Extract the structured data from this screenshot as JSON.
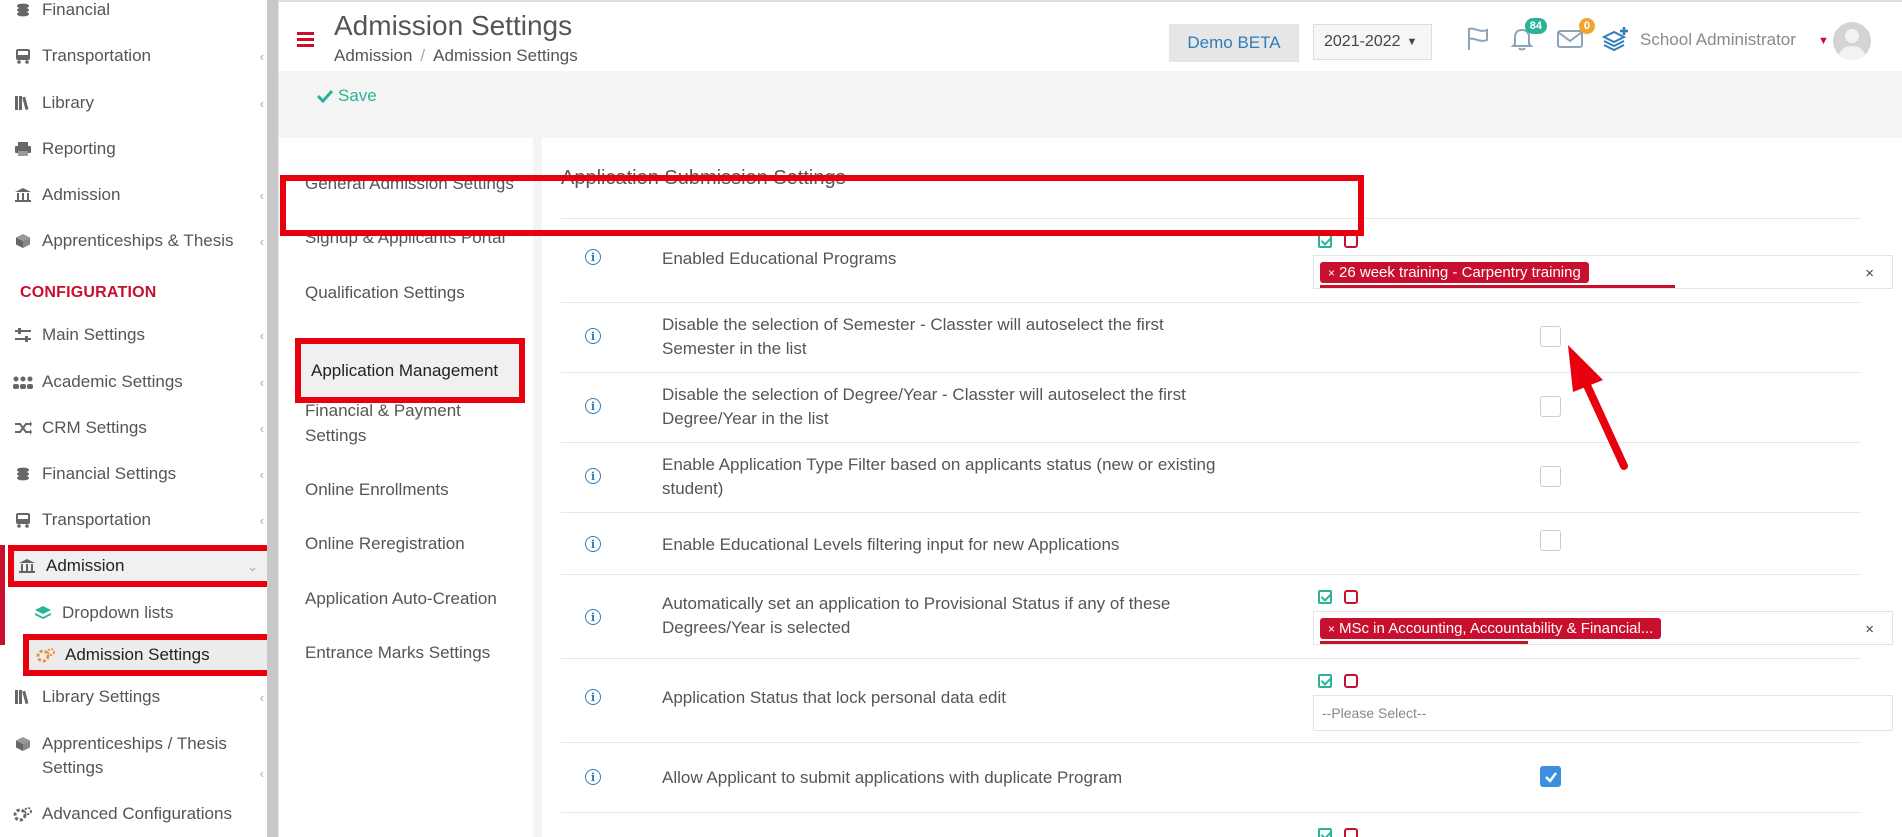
{
  "sidebar": {
    "items": [
      {
        "label": "Financial",
        "icon": "coins-icon"
      },
      {
        "label": "Transportation",
        "icon": "bus-icon"
      },
      {
        "label": "Library",
        "icon": "books-icon"
      },
      {
        "label": "Reporting",
        "icon": "printer-icon"
      },
      {
        "label": "Admission",
        "icon": "institution-icon"
      },
      {
        "label": "Apprenticeships & Thesis",
        "icon": "cube-icon"
      }
    ],
    "section": "CONFIGURATION",
    "config_items": [
      {
        "label": "Main Settings",
        "icon": "sliders-icon"
      },
      {
        "label": "Academic Settings",
        "icon": "users-icon"
      },
      {
        "label": "CRM Settings",
        "icon": "shuffle-icon"
      },
      {
        "label": "Financial Settings",
        "icon": "coins-icon"
      },
      {
        "label": "Transportation",
        "icon": "bus-icon"
      },
      {
        "label": "Admission",
        "icon": "institution-icon"
      },
      {
        "label": "Dropdown lists",
        "icon": "layers-icon"
      },
      {
        "label": "Admission Settings",
        "icon": "cogs-icon"
      },
      {
        "label": "Library Settings",
        "icon": "books-icon"
      },
      {
        "label": "Apprenticeships / Thesis Settings",
        "icon": "cube-icon"
      },
      {
        "label": "Advanced Configurations",
        "icon": "cogs-icon"
      }
    ]
  },
  "header": {
    "title": "Admission Settings",
    "breadcrumb": [
      "Admission",
      "Admission Settings"
    ],
    "demo_label": "Demo BETA",
    "year": "2021-2022",
    "notifications_count": "84",
    "messages_count": "0",
    "user_name": "School Administrator"
  },
  "toolbar": {
    "save_label": "Save"
  },
  "tabs": [
    "General Admission Settings",
    "Signup & Applicants Portal",
    "Qualification Settings",
    "Application Management",
    "Financial & Payment Settings",
    "Online Enrollments",
    "Online Reregistration",
    "Application Auto-Creation",
    "Entrance Marks Settings"
  ],
  "active_tab": "Application Management",
  "panel": {
    "title": "Application Submission Settings",
    "rows": [
      {
        "label": "Enabled Educational Programs",
        "control": "multiselect",
        "tag": "26 week training - Carpentry training"
      },
      {
        "label": "Disable the selection of Semester - Classter will autoselect the first Semester in the list",
        "control": "checkbox",
        "checked": false
      },
      {
        "label": "Disable the selection of Degree/Year - Classter will autoselect the first Degree/Year in the list",
        "control": "checkbox",
        "checked": false
      },
      {
        "label": "Enable Application Type Filter based on applicants status (new or existing student)",
        "control": "checkbox",
        "checked": false
      },
      {
        "label": "Enable Educational Levels filtering input for new Applications",
        "control": "checkbox",
        "checked": false
      },
      {
        "label": "Automatically set an application to Provisional Status if any of these Degrees/Year is selected",
        "control": "multiselect",
        "tag": "MSc in Accounting, Accountability & Financial..."
      },
      {
        "label": "Application Status that lock personal data edit",
        "control": "select",
        "placeholder": "--Please Select--"
      },
      {
        "label": "Allow Applicant to submit applications with duplicate Program",
        "control": "checkbox",
        "checked": true
      }
    ]
  },
  "colors": {
    "brand_red": "#c8102e",
    "accent_blue": "#2f7eb8",
    "save_green": "#2bb39a",
    "highlight": "#e8000f"
  }
}
